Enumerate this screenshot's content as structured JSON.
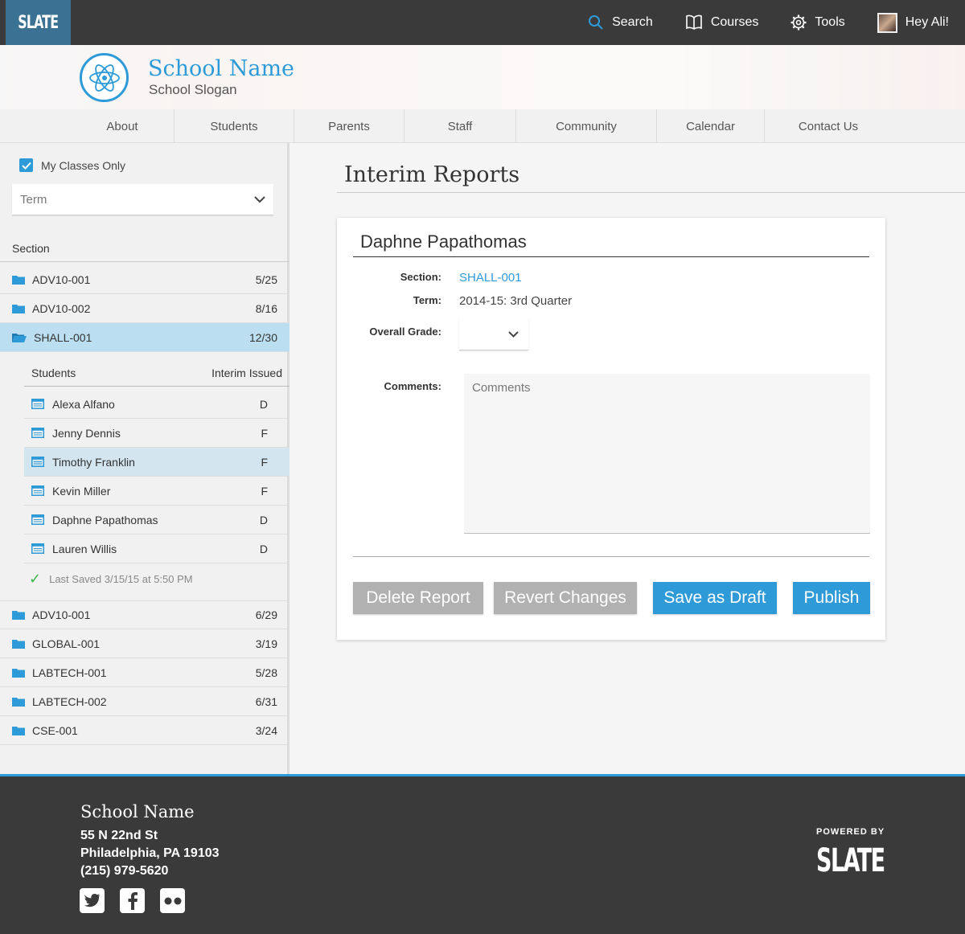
{
  "topbar": {
    "logo": "SLATE",
    "search_label": "Search",
    "courses_label": "Courses",
    "tools_label": "Tools",
    "user_label": "Hey Ali!"
  },
  "banner": {
    "school_name": "School Name",
    "school_slogan": "School Slogan"
  },
  "nav": {
    "items": [
      "About",
      "Students",
      "Parents",
      "Staff",
      "Community",
      "Calendar",
      "Contact Us"
    ]
  },
  "sidebar": {
    "my_classes_label": "My Classes Only",
    "my_classes_checked": true,
    "term_placeholder": "Term",
    "section_header": "Section",
    "sections_top": [
      {
        "name": "ADV10-001",
        "count": "5/25"
      },
      {
        "name": "ADV10-002",
        "count": "8/16"
      },
      {
        "name": "SHALL-001",
        "count": "12/30"
      }
    ],
    "students_header": "Students",
    "interim_header": "Interim Issued",
    "students": [
      {
        "name": "Alexa Alfano",
        "grade": "D"
      },
      {
        "name": "Jenny Dennis",
        "grade": "F"
      },
      {
        "name": "Timothy Franklin",
        "grade": "F"
      },
      {
        "name": "Kevin Miller",
        "grade": "F"
      },
      {
        "name": "Daphne Papathomas",
        "grade": "D"
      },
      {
        "name": "Lauren Willis",
        "grade": "D"
      }
    ],
    "last_saved": "Last Saved 3/15/15 at 5:50 PM",
    "sections_bottom": [
      {
        "name": "ADV10-001",
        "count": "6/29"
      },
      {
        "name": "GLOBAL-001",
        "count": "3/19"
      },
      {
        "name": "LABTECH-001",
        "count": "5/28"
      },
      {
        "name": "LABTECH-002",
        "count": "6/31"
      },
      {
        "name": "CSE-001",
        "count": "3/24"
      }
    ]
  },
  "main": {
    "page_title": "Interim Reports",
    "student_name": "Daphne Papathomas",
    "section_label": "Section:",
    "section_value": "SHALL-001",
    "term_label": "Term:",
    "term_value": "2014-15: 3rd Quarter",
    "grade_label": "Overall Grade:",
    "grade_value": "",
    "comments_label": "Comments:",
    "comments_placeholder": "Comments",
    "buttons": {
      "delete": "Delete Report",
      "revert": "Revert Changes",
      "draft": "Save as Draft",
      "publish": "Publish"
    }
  },
  "footer": {
    "school_name": "School Name",
    "address1": "55 N 22nd St",
    "address2": "Philadelphia, PA 19103",
    "phone": "(215) 979-5620",
    "powered_by": "POWERED BY",
    "slate_logo": "SLATE"
  },
  "colors": {
    "accent": "#2e9ad7",
    "topbar": "#3a3a3a",
    "logo_bg": "#3b7293",
    "active_section": "#bbdff1",
    "active_student": "#d3e5ee",
    "gray_button": "#b1b1b1"
  }
}
